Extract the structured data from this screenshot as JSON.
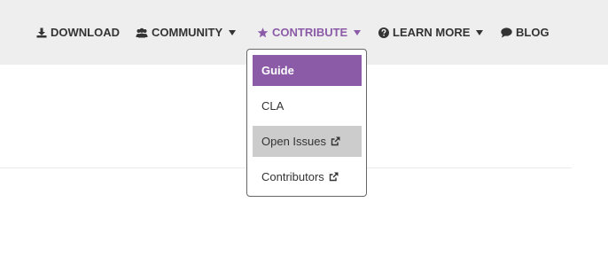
{
  "nav": {
    "download": {
      "label": "DOWNLOAD",
      "icon": "download-icon"
    },
    "community": {
      "label": "COMMUNITY",
      "icon": "users-icon"
    },
    "contribute": {
      "label": "CONTRIBUTE",
      "icon": "star-icon"
    },
    "learn_more": {
      "label": "LEARN MORE",
      "icon": "question-circle-icon"
    },
    "blog": {
      "label": "BLOG",
      "icon": "comment-icon"
    }
  },
  "dropdown": {
    "items": [
      {
        "label": "Guide",
        "state": "selected"
      },
      {
        "label": "CLA"
      },
      {
        "label": "Open Issues",
        "external": true,
        "state": "hover"
      },
      {
        "label": "Contributors",
        "external": true
      }
    ]
  },
  "colors": {
    "accent": "#8b5ba8",
    "navbar_bg": "#eeeeee",
    "text": "#333333",
    "hover_bg": "#cccccc"
  }
}
